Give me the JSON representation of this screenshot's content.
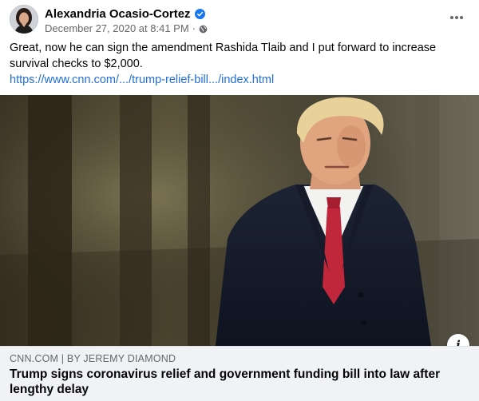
{
  "post": {
    "author": "Alexandria Ocasio-Cortez",
    "date": "December 27, 2020 at 8:41 PM",
    "separator": "·",
    "text": "Great, now he can sign the amendment Rashida Tlaib and I put forward to increase survival checks to $2,000.",
    "link_text": "https://www.cnn.com/.../trump-relief-bill.../index.html",
    "verified_icon": "verified-badge-icon",
    "audience_icon": "globe-icon",
    "more_icon": "ellipsis-icon"
  },
  "preview": {
    "source": "CNN.COM | BY JEREMY DIAMOND",
    "title": "Trump signs coronavirus relief and government funding bill into law after lengthy delay",
    "info_icon": "i"
  },
  "colors": {
    "link": "#216fdb",
    "verified": "#1877f2",
    "meta": "#65676b",
    "footer_bg": "#f0f2f5"
  }
}
